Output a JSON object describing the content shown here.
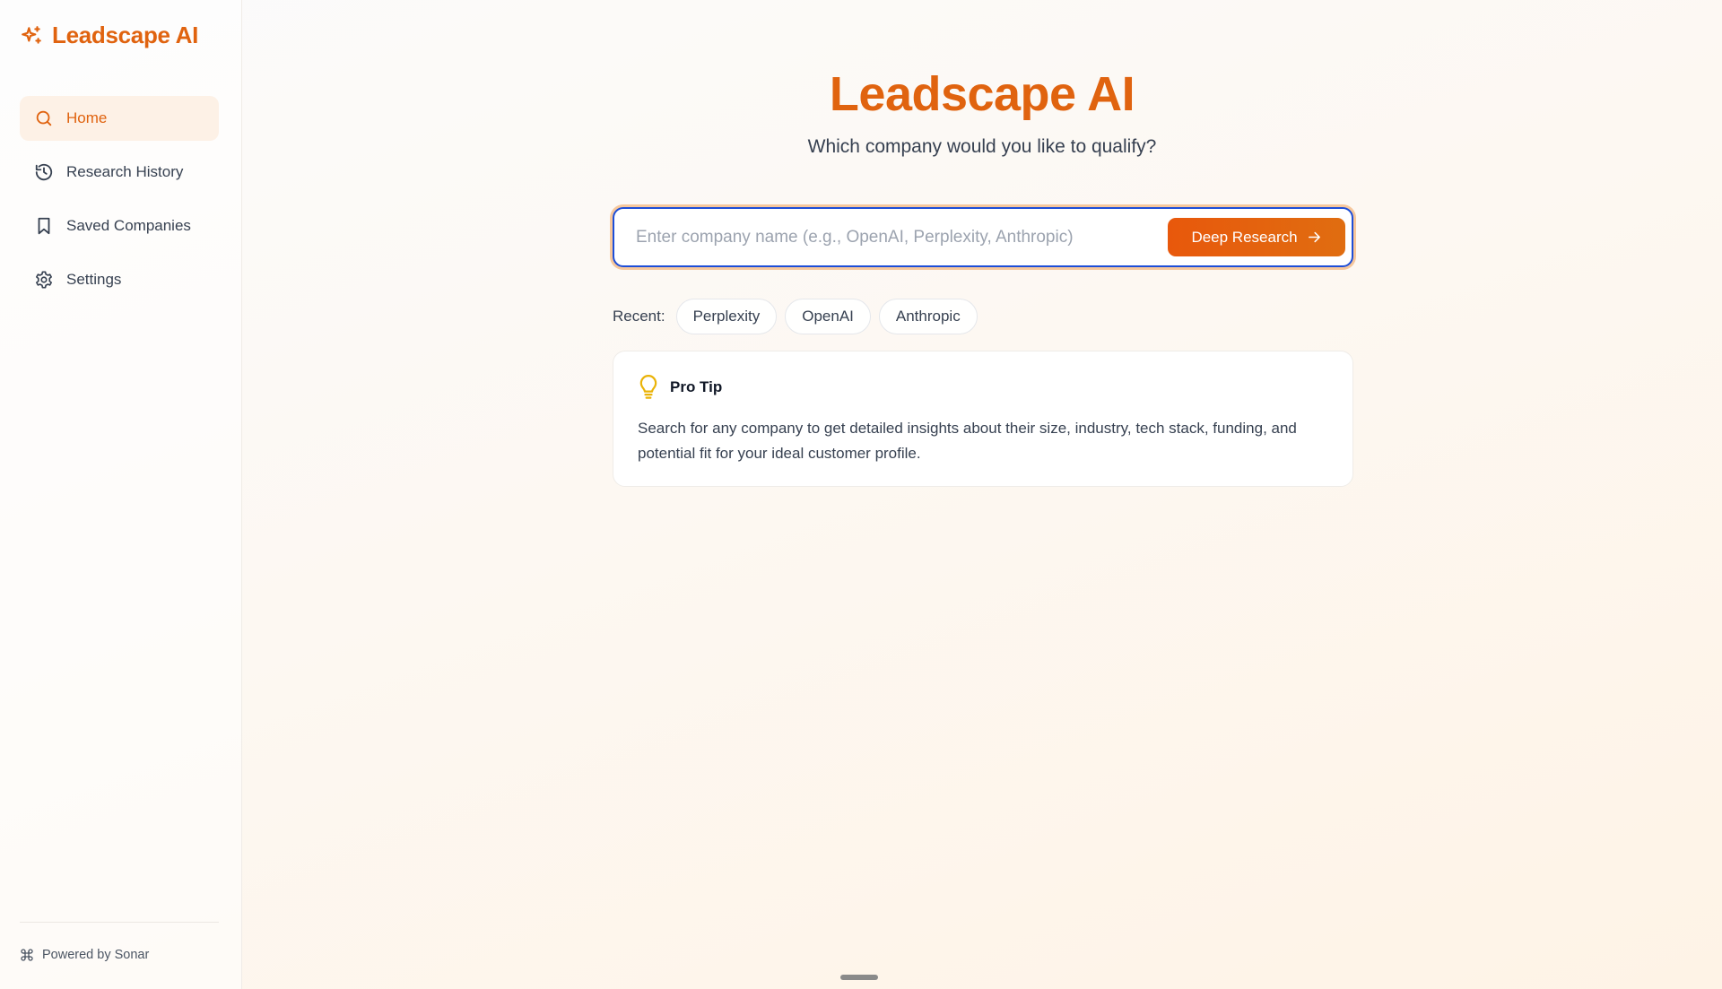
{
  "brand": {
    "name": "Leadscape AI",
    "icon": "sparkles-icon",
    "color": "#e0630f"
  },
  "sidebar": {
    "items": [
      {
        "label": "Home",
        "icon": "search-icon",
        "active": true
      },
      {
        "label": "Research History",
        "icon": "history-icon",
        "active": false
      },
      {
        "label": "Saved Companies",
        "icon": "bookmark-icon",
        "active": false
      },
      {
        "label": "Settings",
        "icon": "gear-icon",
        "active": false
      }
    ],
    "footer": {
      "label": "Powered by Sonar",
      "icon": "command-icon"
    }
  },
  "main": {
    "title": "Leadscape AI",
    "subtitle": "Which company would you like to qualify?",
    "search": {
      "placeholder": "Enter company name (e.g., OpenAI, Perplexity, Anthropic)",
      "value": "",
      "button_label": "Deep Research",
      "button_icon": "arrow-right-icon"
    },
    "recent": {
      "label": "Recent:",
      "chips": [
        "Perplexity",
        "OpenAI",
        "Anthropic"
      ]
    },
    "tip": {
      "icon": "lightbulb-icon",
      "title": "Pro Tip",
      "body": "Search for any company to get detailed insights about their size, industry, tech stack, funding, and potential fit for your ideal customer profile."
    }
  },
  "colors": {
    "accent": "#e0630f",
    "focus_border": "#1d4ed8",
    "button_bg": "#e8580c"
  }
}
